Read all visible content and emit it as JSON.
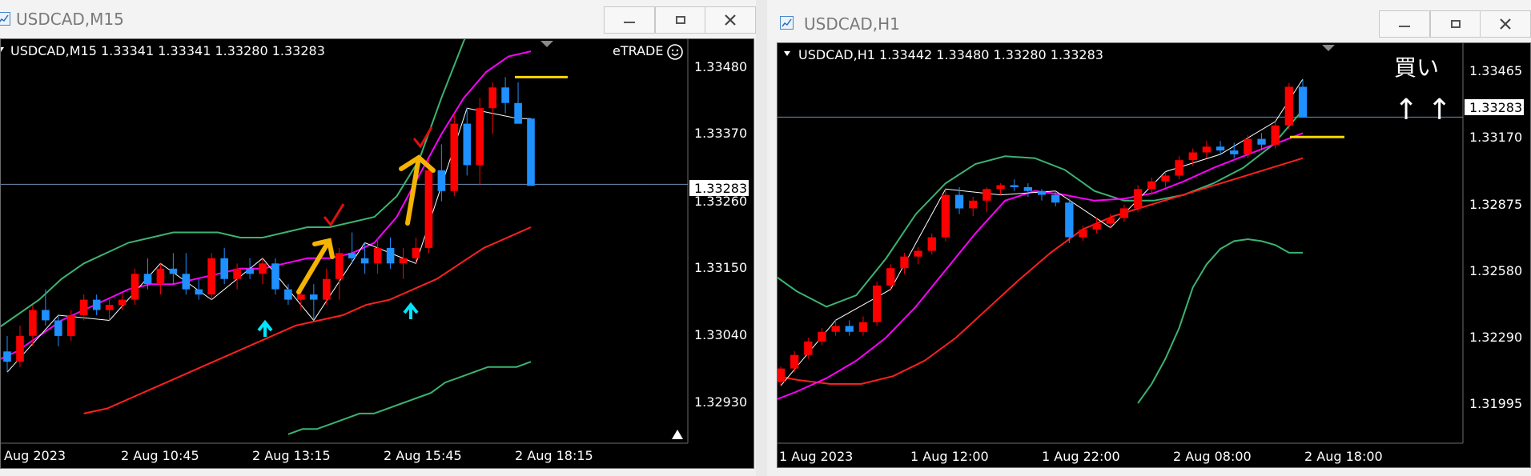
{
  "left_window": {
    "title": "USDCAD,M15",
    "chart_header": "USDCAD,M15  1.33341 1.33341 1.33280 1.33283",
    "broker_label": "eTRADE",
    "current_price": "1.33283",
    "price_axis": [
      "1.33480",
      "1.33370",
      "1.33260",
      "1.33150",
      "1.33040",
      "1.32930"
    ],
    "time_axis": [
      "Aug 2023",
      "2 Aug 10:45",
      "2 Aug 13:15",
      "2 Aug 15:45",
      "2 Aug 18:15"
    ]
  },
  "right_window": {
    "title": "USDCAD,H1",
    "chart_header": "USDCAD,H1  1.33442 1.33480 1.33280 1.33283",
    "annotation_main": "買い",
    "annotation_arrows": "↑ ↑",
    "current_price": "1.33283",
    "price_axis": [
      "1.33465",
      "1.33170",
      "1.32875",
      "1.32580",
      "1.32290",
      "1.31995"
    ],
    "time_axis": [
      "1 Aug 2023",
      "1 Aug 12:00",
      "1 Aug 22:00",
      "2 Aug 08:00",
      "2 Aug 18:00"
    ]
  },
  "colors": {
    "bull_candle": "#ff0000",
    "bear_candle": "#1e90ff",
    "bollinger_band": "#3cb371",
    "ma_fast": "#ff00ff",
    "ma_slow": "#ff2020",
    "marker_yellow": "#ffd700",
    "signal_arrow": "#00e5ff",
    "annotation_arrow": "#f5b400",
    "check_mark": "#e01010"
  },
  "chart_data": [
    {
      "type": "candlestick",
      "symbol": "USDCAD",
      "timeframe": "M15",
      "ohlc_last": {
        "open": 1.33341,
        "high": 1.33341,
        "low": 1.3328,
        "close": 1.33283
      },
      "ylim": [
        1.3286,
        1.3352
      ],
      "yticks": [
        1.3348,
        1.3337,
        1.3326,
        1.3315,
        1.3304,
        1.3293
      ],
      "xticks": [
        "Aug 2023",
        "2 Aug 10:45",
        "2 Aug 13:15",
        "2 Aug 15:45",
        "2 Aug 18:15"
      ],
      "candles": [
        [
          1.3296,
          1.3299,
          1.3292,
          1.3294
        ],
        [
          1.3294,
          1.3301,
          1.3293,
          1.3299
        ],
        [
          1.3299,
          1.3305,
          1.3297,
          1.3304
        ],
        [
          1.3304,
          1.3308,
          1.3301,
          1.3302
        ],
        [
          1.3302,
          1.3303,
          1.3297,
          1.3299
        ],
        [
          1.3299,
          1.3304,
          1.3298,
          1.3303
        ],
        [
          1.3303,
          1.3307,
          1.3302,
          1.3306
        ],
        [
          1.3306,
          1.3307,
          1.3303,
          1.3304
        ],
        [
          1.3304,
          1.3306,
          1.3302,
          1.3305
        ],
        [
          1.3305,
          1.3307,
          1.3304,
          1.3306
        ],
        [
          1.3306,
          1.3312,
          1.3305,
          1.3311
        ],
        [
          1.3311,
          1.3314,
          1.3308,
          1.3309
        ],
        [
          1.3309,
          1.3313,
          1.3307,
          1.3312
        ],
        [
          1.3312,
          1.3315,
          1.3309,
          1.3311
        ],
        [
          1.3311,
          1.3315,
          1.3307,
          1.3308
        ],
        [
          1.3308,
          1.331,
          1.3306,
          1.3307
        ],
        [
          1.3307,
          1.3315,
          1.3306,
          1.3314
        ],
        [
          1.3314,
          1.3316,
          1.3309,
          1.331
        ],
        [
          1.331,
          1.3313,
          1.3308,
          1.3312
        ],
        [
          1.3312,
          1.3314,
          1.331,
          1.3311
        ],
        [
          1.3311,
          1.3314,
          1.3309,
          1.3313
        ],
        [
          1.3313,
          1.3314,
          1.3307,
          1.3308
        ],
        [
          1.3308,
          1.3309,
          1.3305,
          1.3306
        ],
        [
          1.3306,
          1.3308,
          1.3304,
          1.3307
        ],
        [
          1.3307,
          1.3309,
          1.3302,
          1.3306
        ],
        [
          1.3306,
          1.3312,
          1.3305,
          1.331
        ],
        [
          1.331,
          1.3316,
          1.3306,
          1.3315
        ],
        [
          1.3315,
          1.3319,
          1.3313,
          1.3314
        ],
        [
          1.3314,
          1.3317,
          1.3311,
          1.3313
        ],
        [
          1.3313,
          1.3318,
          1.3311,
          1.3316
        ],
        [
          1.3316,
          1.3318,
          1.3312,
          1.3313
        ],
        [
          1.3313,
          1.3316,
          1.331,
          1.3314
        ],
        [
          1.3314,
          1.3318,
          1.3313,
          1.3316
        ],
        [
          1.3316,
          1.3333,
          1.3315,
          1.3331
        ],
        [
          1.3331,
          1.3336,
          1.3325,
          1.3327
        ],
        [
          1.3327,
          1.3342,
          1.3326,
          1.334
        ],
        [
          1.334,
          1.3343,
          1.333,
          1.3332
        ],
        [
          1.3332,
          1.3345,
          1.3328,
          1.3343
        ],
        [
          1.3343,
          1.3348,
          1.3338,
          1.3347
        ],
        [
          1.3347,
          1.3349,
          1.3342,
          1.3344
        ],
        [
          1.3344,
          1.3348,
          1.3341,
          1.334
        ],
        [
          1.3341,
          1.3341,
          1.3328,
          1.3328
        ]
      ],
      "bollinger_upper": [
        1.33,
        1.3303,
        1.3306,
        1.331,
        1.3313,
        1.3315,
        1.3317,
        1.3318,
        1.3319,
        1.3319,
        1.3319,
        1.3318,
        1.3318,
        1.3319,
        1.332,
        1.332,
        1.3321,
        1.3322,
        1.3326,
        1.3333,
        1.3345,
        1.3356,
        1.3365,
        1.3372,
        1.3375
      ],
      "bollinger_lower": [
        1.328,
        1.3281,
        1.3281,
        1.3282,
        1.3283,
        1.3284,
        1.3284,
        1.3285,
        1.3286,
        1.3287,
        1.3288,
        1.329,
        1.3291,
        1.3292,
        1.3293,
        1.3293,
        1.3293,
        1.3294
      ],
      "ma_fast": [
        1.3294,
        1.3296,
        1.3299,
        1.3302,
        1.3304,
        1.3306,
        1.3308,
        1.3309,
        1.3309,
        1.331,
        1.3311,
        1.3312,
        1.3312,
        1.3313,
        1.3314,
        1.3314,
        1.3315,
        1.3317,
        1.3322,
        1.333,
        1.3338,
        1.3345,
        1.335,
        1.3353,
        1.3354
      ],
      "ma_slow": [
        1.3284,
        1.3285,
        1.3287,
        1.3289,
        1.3291,
        1.3293,
        1.3295,
        1.3297,
        1.3299,
        1.3301,
        1.3302,
        1.3303,
        1.3305,
        1.3306,
        1.3308,
        1.331,
        1.3313,
        1.3316,
        1.3318,
        1.332
      ]
    },
    {
      "type": "candlestick",
      "symbol": "USDCAD",
      "timeframe": "H1",
      "ohlc_last": {
        "open": 1.33442,
        "high": 1.3348,
        "low": 1.3328,
        "close": 1.33283
      },
      "ylim": [
        1.318,
        1.3355
      ],
      "yticks": [
        1.33465,
        1.3317,
        1.32875,
        1.3258,
        1.3229,
        1.31995
      ],
      "xticks": [
        "1 Aug 2023",
        "1 Aug 12:00",
        "1 Aug 22:00",
        "2 Aug 08:00",
        "2 Aug 18:00"
      ],
      "candles": [
        [
          1.3191,
          1.3199,
          1.3189,
          1.3198
        ],
        [
          1.3198,
          1.3207,
          1.3196,
          1.3205
        ],
        [
          1.3205,
          1.3214,
          1.3203,
          1.3212
        ],
        [
          1.3212,
          1.3219,
          1.321,
          1.3217
        ],
        [
          1.3217,
          1.3223,
          1.3215,
          1.322
        ],
        [
          1.322,
          1.3223,
          1.3215,
          1.3217
        ],
        [
          1.3217,
          1.3225,
          1.3215,
          1.3222
        ],
        [
          1.3222,
          1.3243,
          1.322,
          1.3241
        ],
        [
          1.3241,
          1.3252,
          1.3239,
          1.325
        ],
        [
          1.325,
          1.3258,
          1.3247,
          1.3256
        ],
        [
          1.3256,
          1.3261,
          1.3252,
          1.3259
        ],
        [
          1.3259,
          1.3268,
          1.3257,
          1.3266
        ],
        [
          1.3266,
          1.3291,
          1.3264,
          1.3288
        ],
        [
          1.3288,
          1.3292,
          1.3278,
          1.3281
        ],
        [
          1.3281,
          1.3287,
          1.3277,
          1.3285
        ],
        [
          1.3285,
          1.3292,
          1.3279,
          1.3291
        ],
        [
          1.3291,
          1.3294,
          1.3288,
          1.3293
        ],
        [
          1.3293,
          1.3296,
          1.329,
          1.3292
        ],
        [
          1.3292,
          1.3294,
          1.3287,
          1.329
        ],
        [
          1.329,
          1.3291,
          1.3285,
          1.3288
        ],
        [
          1.3288,
          1.329,
          1.3282,
          1.3284
        ],
        [
          1.3284,
          1.3286,
          1.3263,
          1.3266
        ],
        [
          1.3266,
          1.3272,
          1.3264,
          1.327
        ],
        [
          1.327,
          1.3276,
          1.3268,
          1.3273
        ],
        [
          1.3273,
          1.3278,
          1.3271,
          1.3276
        ],
        [
          1.3276,
          1.3283,
          1.3274,
          1.3281
        ],
        [
          1.3281,
          1.3293,
          1.3279,
          1.3291
        ],
        [
          1.3291,
          1.3297,
          1.3288,
          1.3295
        ],
        [
          1.3295,
          1.33,
          1.3292,
          1.3298
        ],
        [
          1.3298,
          1.3308,
          1.3296,
          1.3306
        ],
        [
          1.3306,
          1.3312,
          1.3303,
          1.331
        ],
        [
          1.331,
          1.3316,
          1.3307,
          1.3313
        ],
        [
          1.3313,
          1.3316,
          1.3309,
          1.3311
        ],
        [
          1.3311,
          1.3315,
          1.3307,
          1.3309
        ],
        [
          1.3309,
          1.3319,
          1.3307,
          1.3317
        ],
        [
          1.3317,
          1.332,
          1.3311,
          1.3314
        ],
        [
          1.3314,
          1.3326,
          1.3312,
          1.3324
        ],
        [
          1.3324,
          1.3346,
          1.3322,
          1.3344
        ],
        [
          1.3344,
          1.3348,
          1.3328,
          1.3328
        ]
      ],
      "bollinger_upper": [
        1.3249,
        1.3238,
        1.323,
        1.3236,
        1.3255,
        1.3278,
        1.3294,
        1.3304,
        1.3308,
        1.3307,
        1.3301,
        1.329,
        1.3285,
        1.3285,
        1.3288,
        1.3294,
        1.3302,
        1.3314,
        1.3332
      ],
      "bollinger_lower": [
        1.318,
        1.319,
        1.3203,
        1.3219,
        1.324,
        1.3252,
        1.326,
        1.3264,
        1.3265,
        1.3264,
        1.3262,
        1.3258,
        1.3258
      ],
      "ma_fast": [
        1.318,
        1.3186,
        1.3193,
        1.3202,
        1.3214,
        1.323,
        1.3249,
        1.3268,
        1.3285,
        1.329,
        1.3288,
        1.3285,
        1.3286,
        1.3289,
        1.3295,
        1.3302,
        1.3308,
        1.3314,
        1.332
      ],
      "ma_slow": [
        1.3195,
        1.3192,
        1.319,
        1.319,
        1.3194,
        1.3202,
        1.3214,
        1.3229,
        1.3244,
        1.3258,
        1.327,
        1.3277,
        1.3282,
        1.3287,
        1.3292,
        1.3297,
        1.3302,
        1.3307
      ]
    }
  ]
}
